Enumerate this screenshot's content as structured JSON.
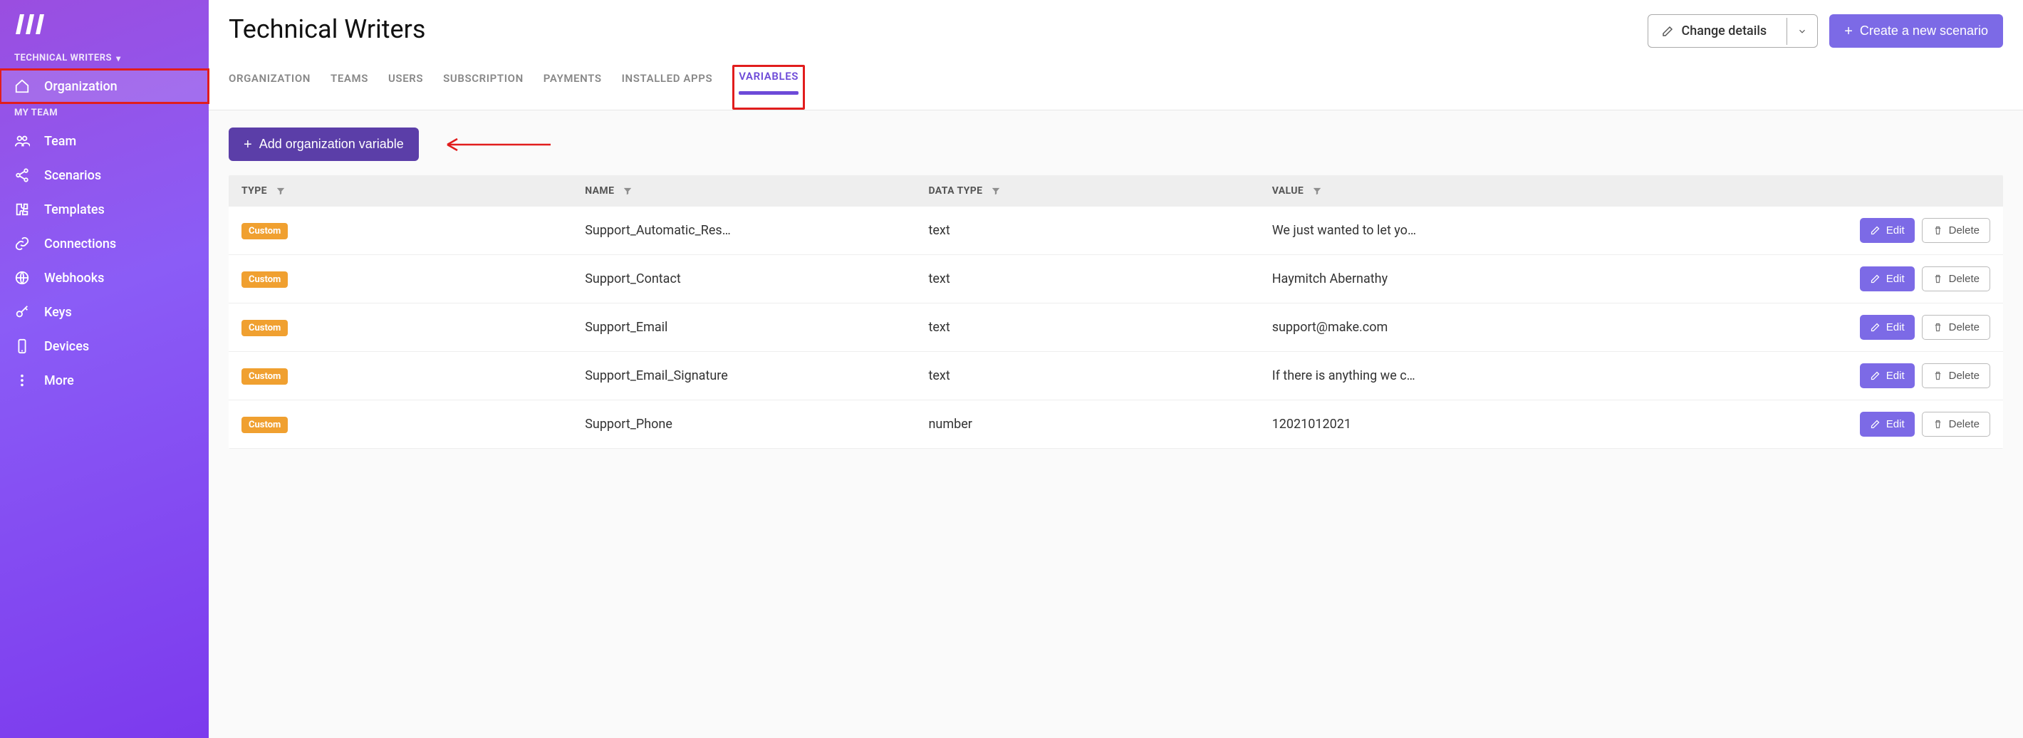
{
  "sidebar": {
    "org_label": "TECHNICAL WRITERS",
    "team_label": "MY TEAM",
    "org_item": "Organization",
    "items": [
      {
        "label": "Team",
        "icon": "users-icon"
      },
      {
        "label": "Scenarios",
        "icon": "share-icon"
      },
      {
        "label": "Templates",
        "icon": "puzzle-icon"
      },
      {
        "label": "Connections",
        "icon": "link-icon"
      },
      {
        "label": "Webhooks",
        "icon": "globe-icon"
      },
      {
        "label": "Keys",
        "icon": "key-icon"
      },
      {
        "label": "Devices",
        "icon": "phone-icon"
      },
      {
        "label": "More",
        "icon": "dots-icon"
      }
    ]
  },
  "header": {
    "title": "Technical Writers",
    "change_details": "Change details",
    "create_scenario": "Create a new scenario"
  },
  "tabs": [
    {
      "label": "ORGANIZATION"
    },
    {
      "label": "TEAMS"
    },
    {
      "label": "USERS"
    },
    {
      "label": "SUBSCRIPTION"
    },
    {
      "label": "PAYMENTS"
    },
    {
      "label": "INSTALLED APPS"
    },
    {
      "label": "VARIABLES",
      "active": true
    }
  ],
  "content": {
    "add_button": "Add organization variable"
  },
  "table": {
    "columns": {
      "type": "TYPE",
      "name": "NAME",
      "datatype": "DATA TYPE",
      "value": "VALUE"
    },
    "type_badge": "Custom",
    "edit_label": "Edit",
    "delete_label": "Delete",
    "rows": [
      {
        "name": "Support_Automatic_Res…",
        "datatype": "text",
        "value": "We just wanted to let yo…"
      },
      {
        "name": "Support_Contact",
        "datatype": "text",
        "value": "Haymitch Abernathy"
      },
      {
        "name": "Support_Email",
        "datatype": "text",
        "value": "support@make.com"
      },
      {
        "name": "Support_Email_Signature",
        "datatype": "text",
        "value": "If there is anything we c…"
      },
      {
        "name": "Support_Phone",
        "datatype": "number",
        "value": "12021012021"
      }
    ]
  }
}
